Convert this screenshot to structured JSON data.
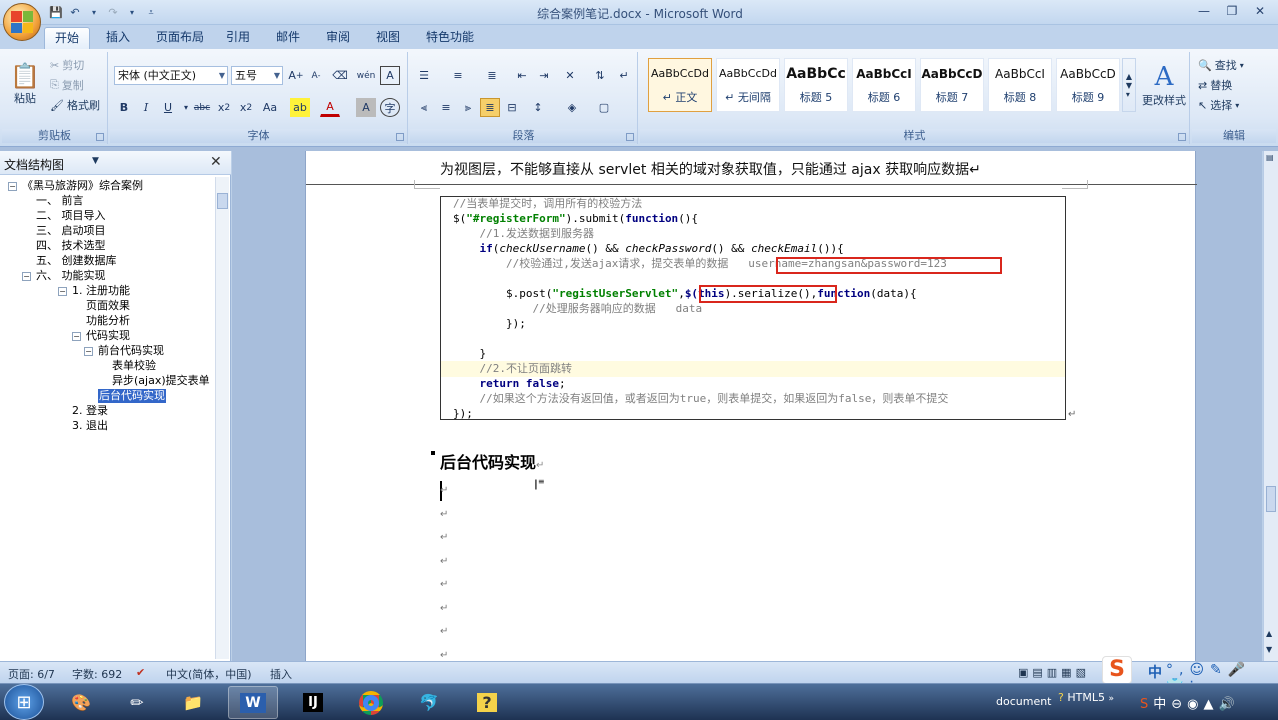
{
  "window": {
    "title": "综合案例笔记.docx - Microsoft Word",
    "controls": [
      "minimize",
      "restore",
      "close"
    ]
  },
  "tabs": [
    "开始",
    "插入",
    "页面布局",
    "引用",
    "邮件",
    "审阅",
    "视图",
    "特色功能"
  ],
  "ribbon": {
    "clipboard": {
      "label": "剪贴板",
      "paste": "粘贴",
      "cut": "剪切",
      "copy": "复制",
      "format_painter": "格式刷"
    },
    "font": {
      "label": "字体",
      "font_name": "宋体 (中文正文)",
      "font_size": "五号"
    },
    "paragraph": {
      "label": "段落"
    },
    "styles": {
      "label": "样式",
      "items": [
        {
          "preview": "AaBbCcDd",
          "name": "↵ 正文"
        },
        {
          "preview": "AaBbCcDd",
          "name": "↵ 无间隔"
        },
        {
          "preview": "AaBbCc",
          "name": "标题 5"
        },
        {
          "preview": "AaBbCcI",
          "name": "标题 6"
        },
        {
          "preview": "AaBbCcD",
          "name": "标题 7"
        },
        {
          "preview": "AaBbCcI",
          "name": "标题 8"
        },
        {
          "preview": "AaBbCcD",
          "name": "标题 9"
        }
      ],
      "change_styles": "更改样式"
    },
    "editing": {
      "label": "编辑",
      "find": "查找",
      "replace": "替换",
      "select": "选择"
    }
  },
  "nav_pane": {
    "title": "文档结构图",
    "items": [
      {
        "text": "《黑马旅游网》综合案例",
        "level": 0,
        "toggle": "−"
      },
      {
        "text": "一、 前言",
        "level": 1
      },
      {
        "text": "二、 项目导入",
        "level": 1
      },
      {
        "text": "三、 启动项目",
        "level": 1
      },
      {
        "text": "四、 技术选型",
        "level": 1
      },
      {
        "text": "五、 创建数据库",
        "level": 1
      },
      {
        "text": "六、 功能实现",
        "level": 1,
        "toggle": "−"
      },
      {
        "text": "1. 注册功能",
        "level": 2,
        "toggle": "−"
      },
      {
        "text": "页面效果",
        "level": 3
      },
      {
        "text": "功能分析",
        "level": 3
      },
      {
        "text": "代码实现",
        "level": 3,
        "toggle": "−"
      },
      {
        "text": "前台代码实现",
        "level": 4,
        "toggle": "−"
      },
      {
        "text": "表单校验",
        "level": 5
      },
      {
        "text": "异步(ajax)提交表单",
        "level": 5
      },
      {
        "text": "后台代码实现",
        "level": 4,
        "selected": true
      },
      {
        "text": "2. 登录",
        "level": 2
      },
      {
        "text": "3. 退出",
        "level": 2
      }
    ]
  },
  "document": {
    "top_text": "为视图层，不能够直接从 servlet 相关的域对象获取值，只能通过 ajax 获取响应数据↵",
    "code_lines": [
      [
        {
          "t": "//当表单提交时，调用所有的校验方法",
          "c": "cm"
        }
      ],
      [
        {
          "t": "$(",
          "c": ""
        },
        {
          "t": "\"#registerForm\"",
          "c": "str"
        },
        {
          "t": ").submit(",
          "c": ""
        },
        {
          "t": "function",
          "c": "kw"
        },
        {
          "t": "(){",
          "c": ""
        }
      ],
      [
        {
          "t": "    //1.发送数据到服务器",
          "c": "cm"
        }
      ],
      [
        {
          "t": "    ",
          "c": ""
        },
        {
          "t": "if",
          "c": "kw"
        },
        {
          "t": "(",
          "c": ""
        },
        {
          "t": "checkUsername",
          "c": "fnc"
        },
        {
          "t": "() && ",
          "c": ""
        },
        {
          "t": "checkPassword",
          "c": "fnc"
        },
        {
          "t": "() && ",
          "c": ""
        },
        {
          "t": "checkEmail",
          "c": "fnc"
        },
        {
          "t": "()){",
          "c": ""
        }
      ],
      [
        {
          "t": "        //校验通过,发送ajax请求，提交表单的数据   ",
          "c": "cm"
        },
        {
          "t": "username=zhangsan&password=123",
          "c": "cm"
        }
      ],
      [
        {
          "t": "",
          "c": ""
        }
      ],
      [
        {
          "t": "        $.post(",
          "c": ""
        },
        {
          "t": "\"registUserServlet\"",
          "c": "str"
        },
        {
          "t": ",",
          "c": ""
        },
        {
          "t": "$(",
          "c": "kw"
        },
        {
          "t": "this",
          "c": "kw"
        },
        {
          "t": ").serialize()",
          "c": ""
        },
        {
          "t": ",",
          "c": ""
        },
        {
          "t": "function",
          "c": "kw"
        },
        {
          "t": "(data){",
          "c": ""
        }
      ],
      [
        {
          "t": "            //处理服务器响应的数据   data",
          "c": "cm"
        }
      ],
      [
        {
          "t": "        });",
          "c": ""
        }
      ],
      [
        {
          "t": "",
          "c": ""
        }
      ],
      [
        {
          "t": "    }",
          "c": ""
        }
      ],
      [
        {
          "t": "    //2.不让页面跳转",
          "c": "cm"
        }
      ],
      [
        {
          "t": "    ",
          "c": ""
        },
        {
          "t": "return false",
          "c": "kw"
        },
        {
          "t": ";",
          "c": ""
        }
      ],
      [
        {
          "t": "    //如果这个方法没有返回值，或者返回为true，则表单提交，如果返回为false，则表单不提交",
          "c": "cm"
        }
      ],
      [
        {
          "t": "});",
          "c": ""
        }
      ]
    ],
    "heading": "后台代码实现",
    "empty_marks": [
      "↵",
      "↵",
      "↵",
      "↵",
      "↵",
      "↵",
      "↵",
      "↵"
    ]
  },
  "statusbar": {
    "page": "页面: 6/7",
    "words": "字数: 692",
    "language": "中文(简体，中国)",
    "mode": "插入"
  },
  "taskbar": {
    "tray_document": "document",
    "tray_html5": "HTML5",
    "ime": "中"
  },
  "colors": {
    "selection": "#3367c9",
    "annotation_red": "#d9261c",
    "string_green": "#008000",
    "keyword_navy": "#000080"
  }
}
